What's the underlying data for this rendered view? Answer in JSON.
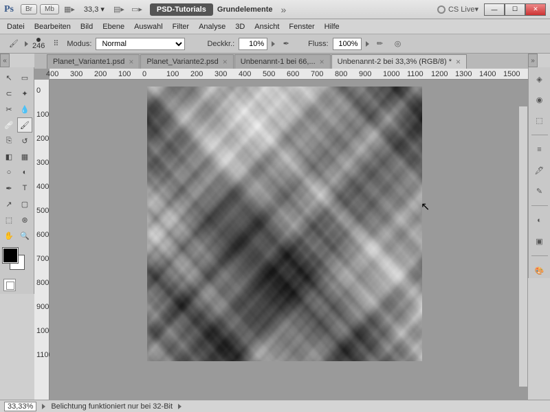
{
  "titlebar": {
    "zoom": "33,3",
    "psd_tut": "PSD-Tutorials",
    "grund": "Grundelemente",
    "cslive": "CS Live"
  },
  "menu": [
    "Datei",
    "Bearbeiten",
    "Bild",
    "Ebene",
    "Auswahl",
    "Filter",
    "Analyse",
    "3D",
    "Ansicht",
    "Fenster",
    "Hilfe"
  ],
  "options": {
    "brush_size": "246",
    "modus_label": "Modus:",
    "modus_value": "Normal",
    "deck_label": "Deckkr.:",
    "deck_value": "10%",
    "fluss_label": "Fluss:",
    "fluss_value": "100%"
  },
  "tabs": [
    {
      "label": "Planet_Variante1.psd",
      "active": false
    },
    {
      "label": "Planet_Variante2.psd",
      "active": false
    },
    {
      "label": "Unbenannt-1 bei 66,...",
      "active": false
    },
    {
      "label": "Unbenannt-2 bei 33,3% (RGB/8) *",
      "active": true
    }
  ],
  "ruler_h": [
    "400",
    "300",
    "200",
    "100",
    "0",
    "100",
    "200",
    "300",
    "400",
    "500",
    "600",
    "700",
    "800",
    "900",
    "1000",
    "1100",
    "1200",
    "1300",
    "1400",
    "1500"
  ],
  "ruler_v": [
    "0",
    "100",
    "200",
    "300",
    "400",
    "500",
    "600",
    "700",
    "800",
    "900",
    "1000",
    "1100"
  ],
  "status": {
    "zoom": "33,33%",
    "msg": "Belichtung funktioniert nur bei 32-Bit"
  },
  "tools_left": [
    "move",
    "marquee",
    "lasso",
    "wand",
    "crop",
    "eyedrop",
    "heal",
    "brush",
    "stamp",
    "history",
    "eraser",
    "gradient",
    "blur",
    "dodge",
    "pen",
    "type",
    "path",
    "shape",
    "3d",
    "3dcam",
    "hand",
    "zoom"
  ],
  "right_icons": [
    "layers",
    "channels",
    "paths",
    "sep",
    "adjust",
    "styles",
    "swatch",
    "sep",
    "nav",
    "histo",
    "sep",
    "color"
  ]
}
